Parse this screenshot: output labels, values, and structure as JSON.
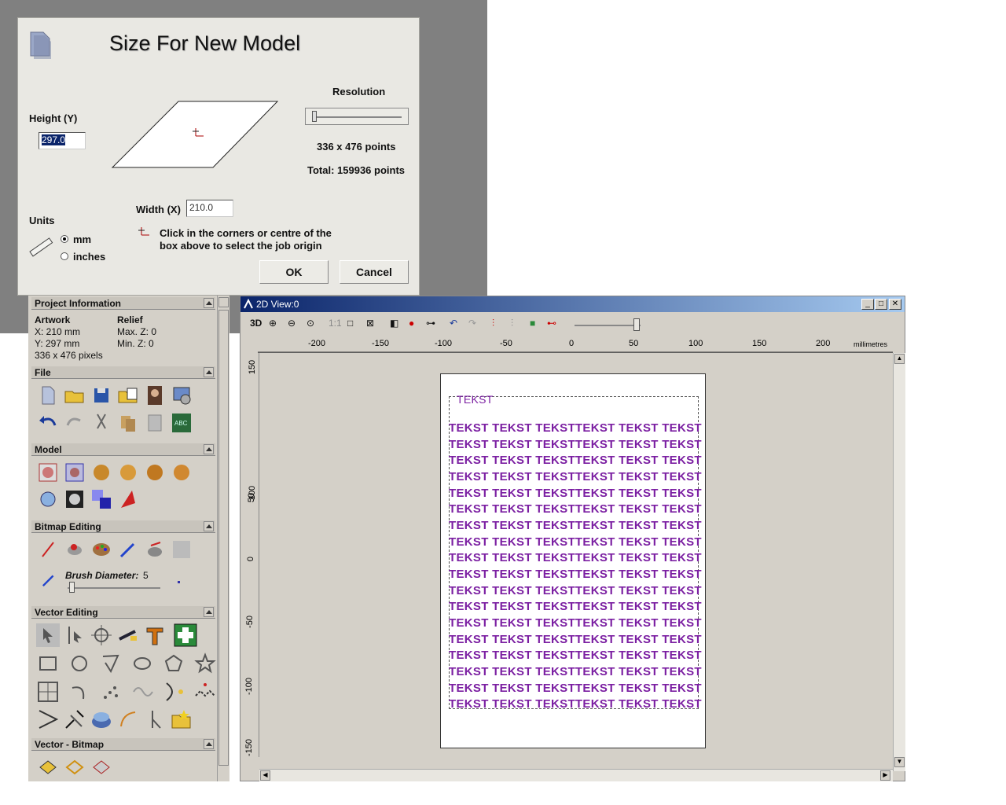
{
  "dialog": {
    "title": "Size For New Model",
    "height_label": "Height (Y)",
    "height_value": "297.0",
    "width_label": "Width (X)",
    "width_value": "210.0",
    "resolution_label": "Resolution",
    "resolution_level": 0.05,
    "points_text": "336 x 476 points",
    "total_text": "Total: 159936 points",
    "units_label": "Units",
    "unit_mm": "mm",
    "unit_inches": "inches",
    "selected_unit": "mm",
    "origin_hint": "Click in the corners or centre of the box above to select the job origin",
    "ok_label": "OK",
    "cancel_label": "Cancel"
  },
  "panel": {
    "project_info": {
      "title": "Project Information",
      "artwork_label": "Artwork",
      "relief_label": "Relief",
      "x": "X: 210 mm",
      "y": "Y: 297 mm",
      "pixels": "336 x 476 pixels",
      "max_z": "Max. Z: 0",
      "min_z": "Min. Z: 0"
    },
    "file_title": "File",
    "model_title": "Model",
    "bitmap_title": "Bitmap Editing",
    "brush_label": "Brush Diameter:",
    "brush_value": "5",
    "vector_title": "Vector Editing",
    "vb_title": "Vector - Bitmap"
  },
  "view": {
    "title": "2D View:0",
    "btn_3d": "3D",
    "btn_11": "1:1",
    "ruler_unit": "millimetres",
    "h_ticks": [
      "-200",
      "-150",
      "-100",
      "-50",
      "0",
      "50",
      "100",
      "150",
      "200"
    ],
    "v_ticks": [
      "150",
      "100",
      "50",
      "0",
      "-50",
      "-100",
      "-150"
    ],
    "heading_text": "TEKST",
    "line_text": "TEKST TEKST TEKSTTEKST TEKST TEKST",
    "line_count": 18
  },
  "colors": {
    "text_purple": "#7b1fa2",
    "titlebar": "#0a246a"
  }
}
